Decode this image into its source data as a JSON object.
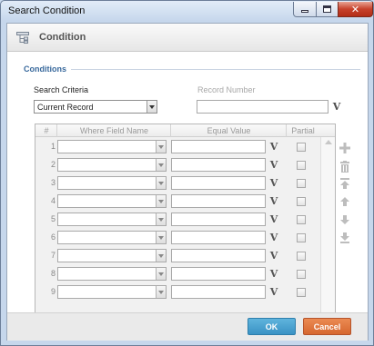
{
  "window": {
    "title": "Search Condition"
  },
  "header": {
    "title": "Condition",
    "icon": "tree-structure-icon"
  },
  "conditions": {
    "section_title": "Conditions",
    "search_criteria_label": "Search Criteria",
    "search_criteria_value": "Current Record",
    "record_number_label": "Record Number",
    "record_number_value": "",
    "v_label": "V"
  },
  "grid": {
    "columns": [
      "#",
      "Where Field Name",
      "Equal Value",
      "Partial"
    ],
    "rows": [
      {
        "num": "1",
        "field": "",
        "value": "",
        "v": "V",
        "partial": false
      },
      {
        "num": "2",
        "field": "",
        "value": "",
        "v": "V",
        "partial": false
      },
      {
        "num": "3",
        "field": "",
        "value": "",
        "v": "V",
        "partial": false
      },
      {
        "num": "4",
        "field": "",
        "value": "",
        "v": "V",
        "partial": false
      },
      {
        "num": "5",
        "field": "",
        "value": "",
        "v": "V",
        "partial": false
      },
      {
        "num": "6",
        "field": "",
        "value": "",
        "v": "V",
        "partial": false
      },
      {
        "num": "7",
        "field": "",
        "value": "",
        "v": "V",
        "partial": false
      },
      {
        "num": "8",
        "field": "",
        "value": "",
        "v": "V",
        "partial": false
      },
      {
        "num": "9",
        "field": "",
        "value": "",
        "v": "V",
        "partial": false
      }
    ]
  },
  "side_toolbar": [
    "add-icon",
    "delete-icon",
    "move-top-icon",
    "move-up-icon",
    "move-down-icon",
    "move-bottom-icon"
  ],
  "footer": {
    "ok_label": "OK",
    "cancel_label": "Cancel"
  },
  "colors": {
    "ok": "#3a92c4",
    "cancel": "#d6672f",
    "section": "#3a6a9d"
  }
}
